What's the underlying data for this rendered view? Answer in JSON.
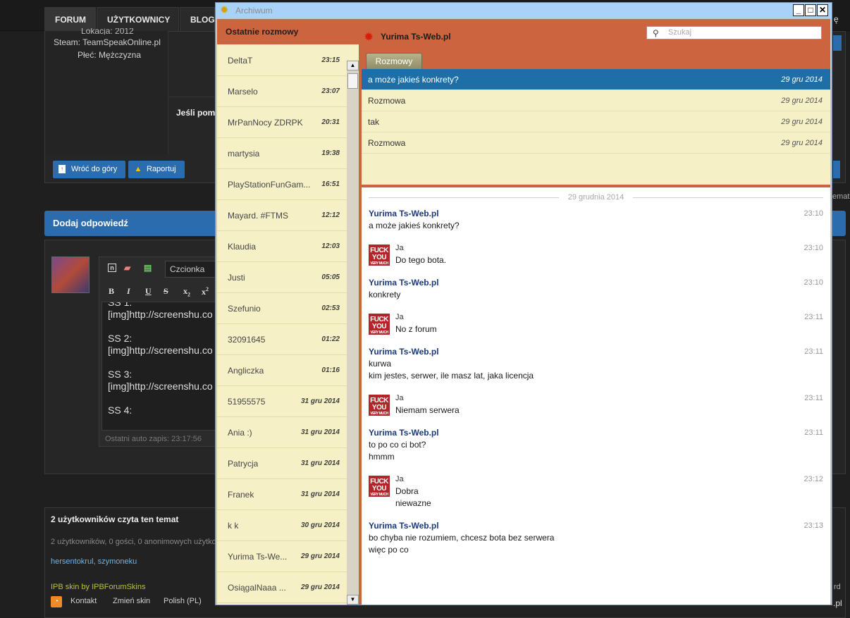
{
  "forum": {
    "nav_tabs": [
      "FORUM",
      "UŻYTKOWNICY",
      "BLOG"
    ],
    "profile_lines": [
      "Lokacja: 2012",
      "Steam: TeamSpeakOnline.pl",
      "Płeć: Mężczyzna"
    ],
    "partial_post": "Jeśli pom",
    "back_top_btn": "Wróć do góry",
    "report_btn": "Raportuj",
    "reply_header": "Dodaj odpowiedź",
    "font_select": "Czcionka",
    "editor_text": "SS 1:\n[img]http://screenshu.co\n\nSS 2:\n[img]http://screenshu.co\n\nSS 3:\n[img]http://screenshu.co\n\nSS 4:",
    "autosave": "Ostatni auto zapis: 23:17:56",
    "readers_title": "2 użytkowników czyta ten temat",
    "readers_detail": "2 użytkowników, 0 gości, 0 anonimowych użytko",
    "readers_names": "hersentokrul, szymoneku",
    "skin_credit": "IPB skin by IPBForumSkins",
    "footer_links": [
      "Kontakt",
      "Zmień skin",
      "Polish (PL)"
    ],
    "right_snips": [
      "ę",
      "emat",
      "rd",
      ".pl"
    ]
  },
  "window": {
    "title": "Archiwum",
    "controls": [
      "_",
      "□",
      "✕"
    ],
    "left_header": "Ostatnie rozmowy",
    "contacts": [
      {
        "name": "DeltaT",
        "time": "23:15"
      },
      {
        "name": "Marselo",
        "time": "23:07"
      },
      {
        "name": "MrPanNocy ZDRPK",
        "time": "20:31"
      },
      {
        "name": "martysia",
        "time": "19:38"
      },
      {
        "name": "PlayStationFunGam...",
        "time": "16:51"
      },
      {
        "name": "Mayard. #FTMS",
        "time": "12:12"
      },
      {
        "name": "Klaudia",
        "time": "12:03"
      },
      {
        "name": "Justi",
        "time": "05:05"
      },
      {
        "name": "Szefunio",
        "time": "02:53"
      },
      {
        "name": "32091645",
        "time": "01:22"
      },
      {
        "name": "Angliczka",
        "time": "01:16"
      },
      {
        "name": "51955575",
        "time": "31 gru 2014"
      },
      {
        "name": "Ania :)",
        "time": "31 gru 2014"
      },
      {
        "name": "Patrycja",
        "time": "31 gru 2014"
      },
      {
        "name": "Franek",
        "time": "31 gru 2014"
      },
      {
        "name": "k k",
        "time": "30 gru 2014"
      },
      {
        "name": "Yurima Ts-We...",
        "time": "29 gru 2014"
      },
      {
        "name": "OsiągalNaaa ...",
        "time": "29 gru 2014"
      }
    ],
    "conversation_name": "Yurima Ts-Web.pl",
    "search_placeholder": "Szukaj",
    "tab_label": "Rozmowy",
    "threads": [
      {
        "subject": "a może jakieś konkrety?",
        "date": "29 gru 2014",
        "selected": true
      },
      {
        "subject": "Rozmowa",
        "date": "29 gru 2014",
        "selected": false
      },
      {
        "subject": "tak",
        "date": "29 gru 2014",
        "selected": false
      },
      {
        "subject": "Rozmowa",
        "date": "29 gru 2014",
        "selected": false
      }
    ],
    "date_separator": "29 grudnia 2014",
    "avatar_text": {
      "line1": "FUCK",
      "line2": "YOU",
      "line3": "VERY MUCH"
    },
    "messages": [
      {
        "from": "Yurima Ts-Web.pl",
        "me": false,
        "time": "23:10",
        "text": "a może jakieś konkrety?"
      },
      {
        "from": "Ja",
        "me": true,
        "time": "23:10",
        "text": "Do tego bota."
      },
      {
        "from": "Yurima Ts-Web.pl",
        "me": false,
        "time": "23:10",
        "text": "konkrety"
      },
      {
        "from": "Ja",
        "me": true,
        "time": "23:11",
        "text": "No z forum"
      },
      {
        "from": "Yurima Ts-Web.pl",
        "me": false,
        "time": "23:11",
        "text": "kurwa\nkim jestes, serwer, ile masz lat, jaka licencja"
      },
      {
        "from": "Ja",
        "me": true,
        "time": "23:11",
        "text": "Niemam serwera"
      },
      {
        "from": "Yurima Ts-Web.pl",
        "me": false,
        "time": "23:11",
        "text": "to po co ci bot?\nhmmm"
      },
      {
        "from": "Ja",
        "me": true,
        "time": "23:12",
        "text": "Dobra\nniewazne"
      },
      {
        "from": "Yurima Ts-Web.pl",
        "me": false,
        "time": "23:13",
        "text": "bo chyba nie rozumiem, chcesz bota bez serwera\nwięc po co"
      }
    ]
  }
}
